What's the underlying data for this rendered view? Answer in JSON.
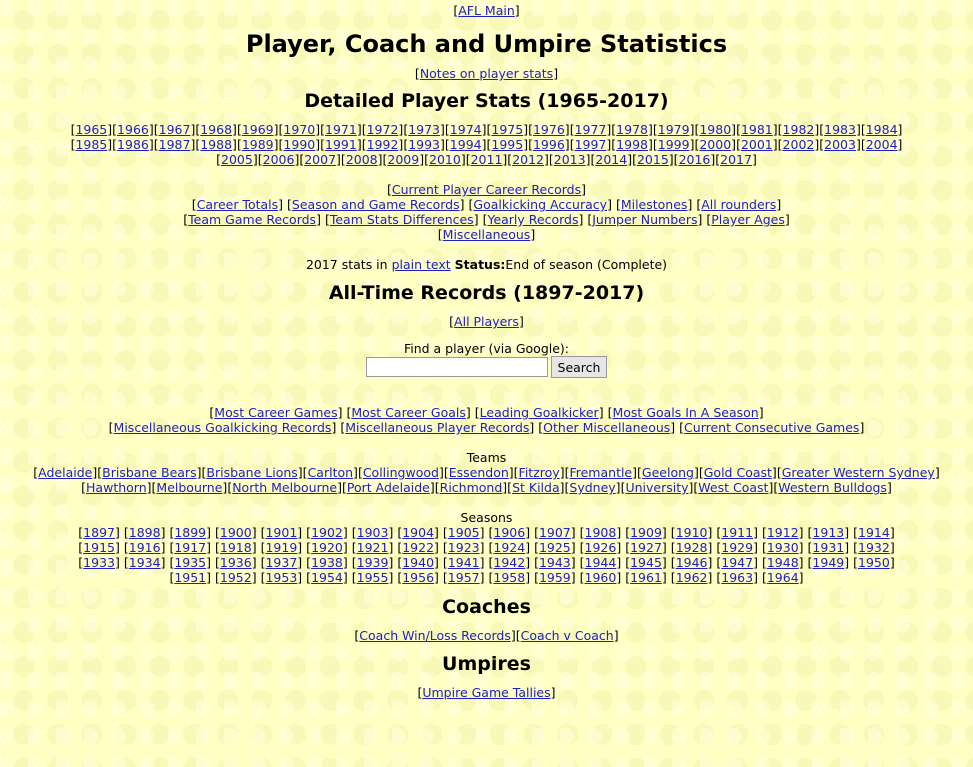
{
  "top_link": "AFL Main",
  "page_title": "Player, Coach and Umpire Statistics",
  "notes_link": "Notes on player stats",
  "detailed": {
    "heading": "Detailed Player Stats (1965-2017)",
    "years_row1": [
      "1965",
      "1966",
      "1967",
      "1968",
      "1969",
      "1970",
      "1971",
      "1972",
      "1973",
      "1974",
      "1975",
      "1976",
      "1977",
      "1978",
      "1979",
      "1980",
      "1981",
      "1982",
      "1983",
      "1984"
    ],
    "years_row2": [
      "1985",
      "1986",
      "1987",
      "1988",
      "1989",
      "1990",
      "1991",
      "1992",
      "1993",
      "1994",
      "1995",
      "1996",
      "1997",
      "1998",
      "1999",
      "2000",
      "2001",
      "2002",
      "2003",
      "2004"
    ],
    "years_row3": [
      "2005",
      "2006",
      "2007",
      "2008",
      "2009",
      "2010",
      "2011",
      "2012",
      "2013",
      "2014",
      "2015",
      "2016",
      "2017"
    ],
    "links_row1": [
      "Current Player Career Records"
    ],
    "links_row2": [
      "Career Totals",
      "Season and Game Records",
      "Goalkicking Accuracy",
      "Milestones",
      "All rounders"
    ],
    "links_row3": [
      "Team Game Records",
      "Team Stats Differences",
      "Yearly Records",
      "Jumper Numbers",
      "Player Ages"
    ],
    "links_row4": [
      "Miscellaneous"
    ],
    "status_prefix": "2017 stats in",
    "plain_text_link": "plain text",
    "status_label": "Status:",
    "status_value": "End of season (Complete)"
  },
  "alltime": {
    "heading": "All-Time Records (1897-2017)",
    "all_players_link": "All Players",
    "search_label": "Find a player (via Google):",
    "search_value": "",
    "search_button": "Search",
    "records_row1": [
      "Most Career Games",
      "Most Career Goals",
      "Leading Goalkicker",
      "Most Goals In A Season"
    ],
    "records_row2": [
      "Miscellaneous Goalkicking Records",
      "Miscellaneous Player Records",
      "Other Miscellaneous",
      "Current Consecutive Games"
    ],
    "teams_label": "Teams",
    "teams_row1": [
      "Adelaide",
      "Brisbane Bears",
      "Brisbane Lions",
      "Carlton",
      "Collingwood",
      "Essendon",
      "Fitzroy",
      "Fremantle",
      "Geelong",
      "Gold Coast",
      "Greater Western Sydney"
    ],
    "teams_row2": [
      "Hawthorn",
      "Melbourne",
      "North Melbourne",
      "Port Adelaide",
      "Richmond",
      "St Kilda",
      "Sydney",
      "University",
      "West Coast",
      "Western Bulldogs"
    ],
    "seasons_label": "Seasons",
    "seasons_row1": [
      "1897",
      "1898",
      "1899",
      "1900",
      "1901",
      "1902",
      "1903",
      "1904",
      "1905",
      "1906",
      "1907",
      "1908",
      "1909",
      "1910",
      "1911",
      "1912",
      "1913",
      "1914"
    ],
    "seasons_row2": [
      "1915",
      "1916",
      "1917",
      "1918",
      "1919",
      "1920",
      "1921",
      "1922",
      "1923",
      "1924",
      "1925",
      "1926",
      "1927",
      "1928",
      "1929",
      "1930",
      "1931",
      "1932"
    ],
    "seasons_row3": [
      "1933",
      "1934",
      "1935",
      "1936",
      "1937",
      "1938",
      "1939",
      "1940",
      "1941",
      "1942",
      "1943",
      "1944",
      "1945",
      "1946",
      "1947",
      "1948",
      "1949",
      "1950"
    ],
    "seasons_row4": [
      "1951",
      "1952",
      "1953",
      "1954",
      "1955",
      "1956",
      "1957",
      "1958",
      "1959",
      "1960",
      "1961",
      "1962",
      "1963",
      "1964"
    ]
  },
  "coaches": {
    "heading": "Coaches",
    "links": [
      "Coach Win/Loss Records",
      "Coach v Coach"
    ]
  },
  "umpires": {
    "heading": "Umpires",
    "links": [
      "Umpire Game Tallies"
    ]
  }
}
